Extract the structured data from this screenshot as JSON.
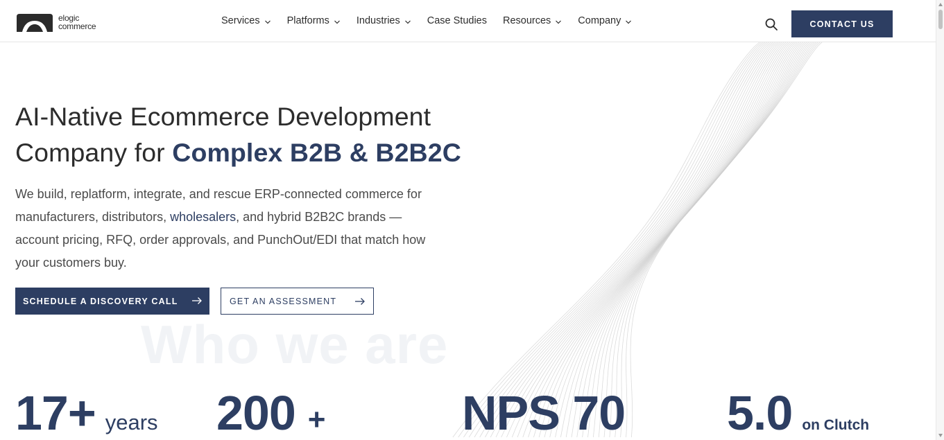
{
  "header": {
    "logo": {
      "line1": "elogic",
      "line2": "commerce"
    },
    "nav": [
      {
        "label": "Services",
        "has_dropdown": true
      },
      {
        "label": "Platforms",
        "has_dropdown": true
      },
      {
        "label": "Industries",
        "has_dropdown": true
      },
      {
        "label": "Case Studies",
        "has_dropdown": false
      },
      {
        "label": "Resources",
        "has_dropdown": true
      },
      {
        "label": "Company",
        "has_dropdown": true
      }
    ],
    "search_icon": "search-icon",
    "contact_label": "CONTACT US"
  },
  "hero": {
    "title_line1": "AI-Native Ecommerce Development",
    "title_line2_prefix": "Company for ",
    "title_line2_highlight": "Complex B2B & B2B2C",
    "desc_part1": "We build, replatform, integrate, and rescue ERP-connected commerce for manufacturers, distributors, ",
    "desc_link": "wholesalers",
    "desc_part2": ", and hybrid B2B2C brands — account pricing, RFQ, order approvals, and PunchOut/EDI that match how your customers buy.",
    "primary_cta": "SCHEDULE A DISCOVERY CALL",
    "secondary_cta": "GET AN ASSESSMENT",
    "watermark": "Who we are"
  },
  "stats": [
    {
      "value": "17+",
      "unit": "years"
    },
    {
      "value": "200",
      "unit": "+"
    },
    {
      "value": "NPS 70",
      "unit": ""
    },
    {
      "value": "5.0",
      "unit": "on Clutch"
    }
  ],
  "colors": {
    "brand": "#2d3e62",
    "text": "#2c2c2c",
    "wave": "#cfcfcf"
  }
}
